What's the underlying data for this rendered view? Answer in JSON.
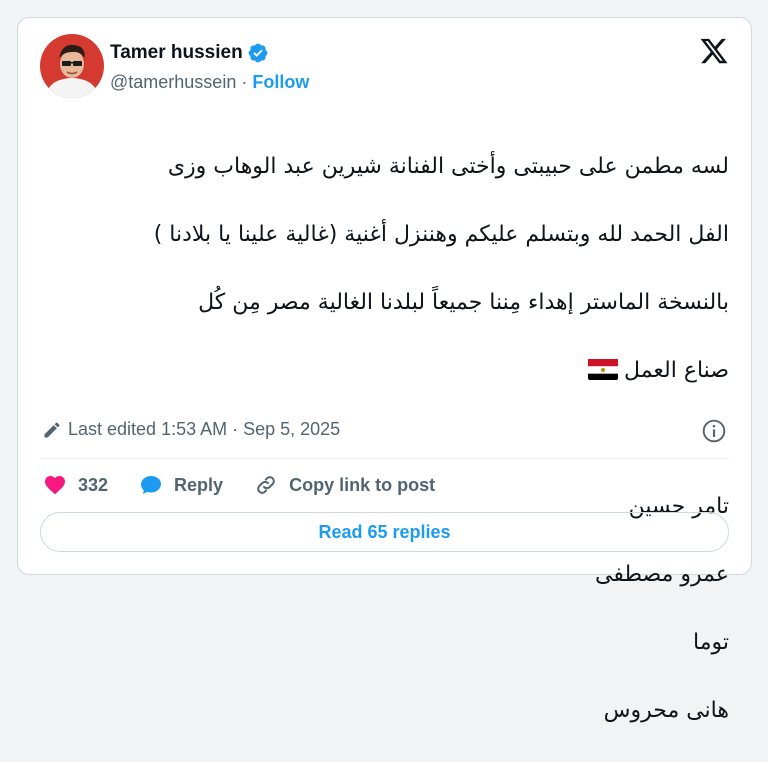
{
  "author": {
    "name": "Tamer hussien",
    "handle": "@tamerhussein",
    "separator": " · ",
    "follow_label": "Follow",
    "verified_icon": "verified-badge-icon",
    "avatar": "profile-photo"
  },
  "brand": {
    "logo_icon": "x-logo-icon"
  },
  "tweet": {
    "lines": [
      "لسه مطمن على حبيبتى وأختى الفنانة شيرين عبد الوهاب وزى",
      "الفل الحمد لله  وبتسلم عليكم وهننزل  أغنية (غالية علينا يا بلادنا )",
      "بالنسخة الماستر إهداء مِننا جميعاً لبلدنا الغالية مصر مِن كُل",
      "صناع العمل"
    ],
    "flag_icon": "egypt-flag-icon",
    "credits": [
      "تامر حسين",
      "عمرو مصطفى",
      "توما",
      "هانى محروس"
    ]
  },
  "meta": {
    "edited_text": "Last edited 1:53 AM · Sep 5, 2025",
    "edit_icon": "pencil-icon",
    "info_icon": "info-icon"
  },
  "actions": {
    "likes_count": "332",
    "reply_label": "Reply",
    "copy_link_label": "Copy link to post"
  },
  "footer": {
    "read_replies_label": "Read 65 replies"
  },
  "colors": {
    "accent": "#1d9bf0",
    "like": "#f91880",
    "text_primary": "#0f1419",
    "text_secondary": "#536471",
    "border": "#cfd9de"
  }
}
